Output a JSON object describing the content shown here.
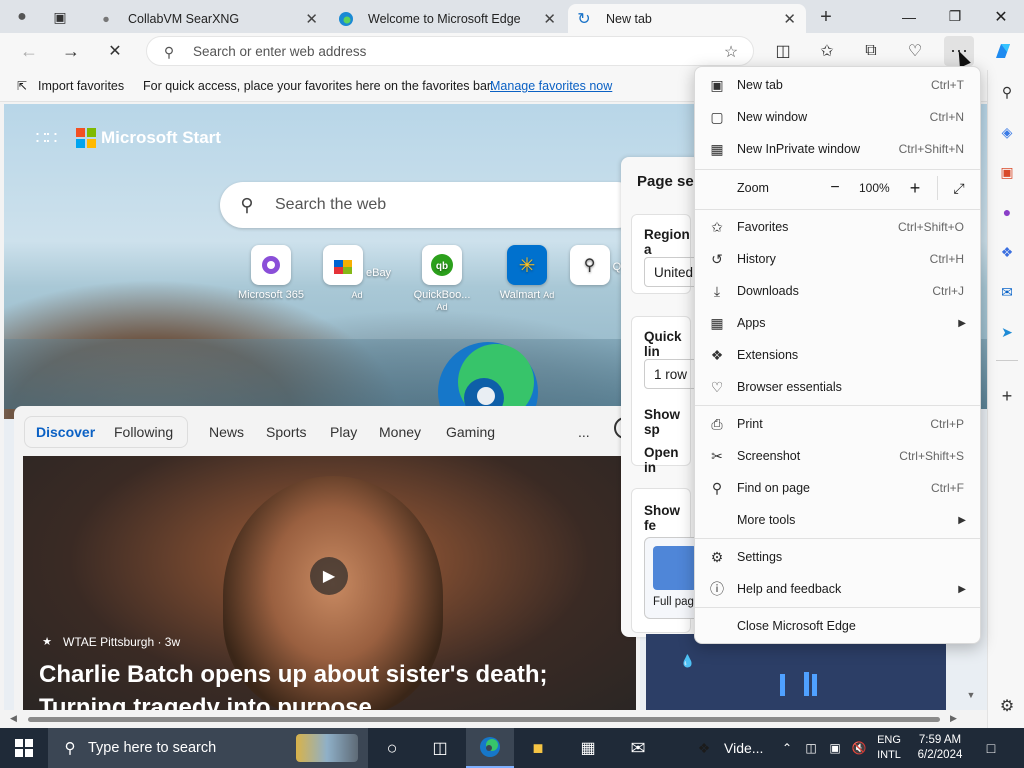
{
  "tabs": [
    {
      "title": "CollabVM SearXNG"
    },
    {
      "title": "Welcome to Microsoft Edge"
    },
    {
      "title": "New tab"
    }
  ],
  "address": {
    "placeholder": "Search or enter web address"
  },
  "favorites_bar": {
    "import_label": "Import favorites",
    "hint": "For quick access, place your favorites here on the favorites bar.",
    "manage_link": "Manage favorites now"
  },
  "start": {
    "brand": "Microsoft Start",
    "search_placeholder": "Search the web",
    "tiles": [
      {
        "label": "Microsoft 365",
        "ad": ""
      },
      {
        "label": "eBay",
        "ad": "Ad"
      },
      {
        "label": "QuickBoo...",
        "ad": "Ad"
      },
      {
        "label": "Walmart",
        "ad": "Ad"
      },
      {
        "label": "QVC",
        "ad": ""
      }
    ],
    "feed_nav": [
      "Discover",
      "Following",
      "News",
      "Sports",
      "Play",
      "Money",
      "Gaming"
    ],
    "more_label": "...",
    "article": {
      "source": "WTAE Pittsburgh · 3w",
      "headline": "Charlie Batch opens up about sister's death; Turning tragedy into purpose"
    }
  },
  "page_settings": {
    "title": "Page se",
    "region_label": "Region a",
    "region_value": "United",
    "quick_links_label": "Quick lin",
    "rows_value": "1 row",
    "show_sp": "Show sp",
    "open_in": "Open in",
    "show_fe": "Show fe",
    "layout_label": "Full pag"
  },
  "menu": {
    "items_group1": [
      {
        "label": "New tab",
        "shortcut": "Ctrl+T",
        "icon": "new-tab-icon"
      },
      {
        "label": "New window",
        "shortcut": "Ctrl+N",
        "icon": "new-window-icon"
      },
      {
        "label": "New InPrivate window",
        "shortcut": "Ctrl+Shift+N",
        "icon": "inprivate-icon"
      }
    ],
    "zoom": {
      "label": "Zoom",
      "value": "100%"
    },
    "items_group2": [
      {
        "label": "Favorites",
        "shortcut": "Ctrl+Shift+O",
        "icon": "star-icon"
      },
      {
        "label": "History",
        "shortcut": "Ctrl+H",
        "icon": "history-icon"
      },
      {
        "label": "Downloads",
        "shortcut": "Ctrl+J",
        "icon": "download-icon"
      },
      {
        "label": "Apps",
        "shortcut": "",
        "icon": "apps-icon"
      },
      {
        "label": "Extensions",
        "shortcut": "",
        "icon": "extensions-icon"
      },
      {
        "label": "Browser essentials",
        "shortcut": "",
        "icon": "heart-pulse-icon"
      }
    ],
    "items_group3": [
      {
        "label": "Print",
        "shortcut": "Ctrl+P",
        "icon": "print-icon"
      },
      {
        "label": "Screenshot",
        "shortcut": "Ctrl+Shift+S",
        "icon": "screenshot-icon"
      },
      {
        "label": "Find on page",
        "shortcut": "Ctrl+F",
        "icon": "find-icon"
      },
      {
        "label": "More tools",
        "shortcut": "",
        "icon": "more-tools-icon"
      }
    ],
    "items_group4": [
      {
        "label": "Settings",
        "shortcut": "",
        "icon": "gear-icon"
      },
      {
        "label": "Help and feedback",
        "shortcut": "",
        "icon": "help-icon"
      }
    ],
    "close_label": "Close Microsoft Edge"
  },
  "taskbar": {
    "search_placeholder": "Type here to search",
    "video_label": "Vide...",
    "lang_top": "ENG",
    "lang_bottom": "INTL",
    "time": "7:59 AM",
    "date": "6/2/2024"
  }
}
